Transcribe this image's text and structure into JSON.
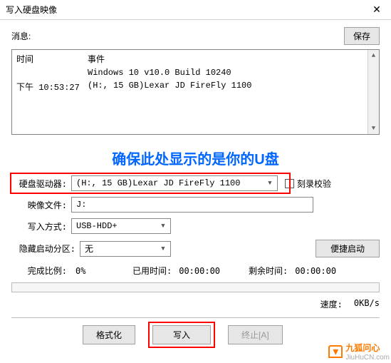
{
  "window": {
    "title": "写入硬盘映像",
    "close": "✕"
  },
  "msg_label": "消息:",
  "save_btn": "保存",
  "log": {
    "col_time": "时间",
    "col_event": "事件",
    "event1": "Windows 10 v10.0 Build 10240",
    "time2": "下午 10:53:27",
    "event2": "(H:, 15 GB)Lexar   JD FireFly     1100"
  },
  "annotation": "确保此处显示的是你的U盘",
  "drive": {
    "label": "硬盘驱动器:",
    "value": "(H:, 15 GB)Lexar   JD FireFly     1100"
  },
  "verify_checkbox": "刻录校验",
  "image_file": {
    "label": "映像文件:",
    "value": "J:"
  },
  "write_mode": {
    "label": "写入方式:",
    "value": "USB-HDD+"
  },
  "hidden_part": {
    "label": "隐藏启动分区:",
    "value": "无"
  },
  "easy_boot_btn": "便捷启动",
  "progress": {
    "label": "完成比例:",
    "value": "0%",
    "elapsed_label": "已用时间:",
    "elapsed": "00:00:00",
    "remain_label": "剩余时间:",
    "remain": "00:00:00"
  },
  "speed": {
    "label": "速度:",
    "value": "0KB/s"
  },
  "buttons": {
    "format": "格式化",
    "write": "写入",
    "abort": "终止[A]"
  },
  "watermark": {
    "name": "九狐问心",
    "url": "JiuHuCN.com"
  }
}
